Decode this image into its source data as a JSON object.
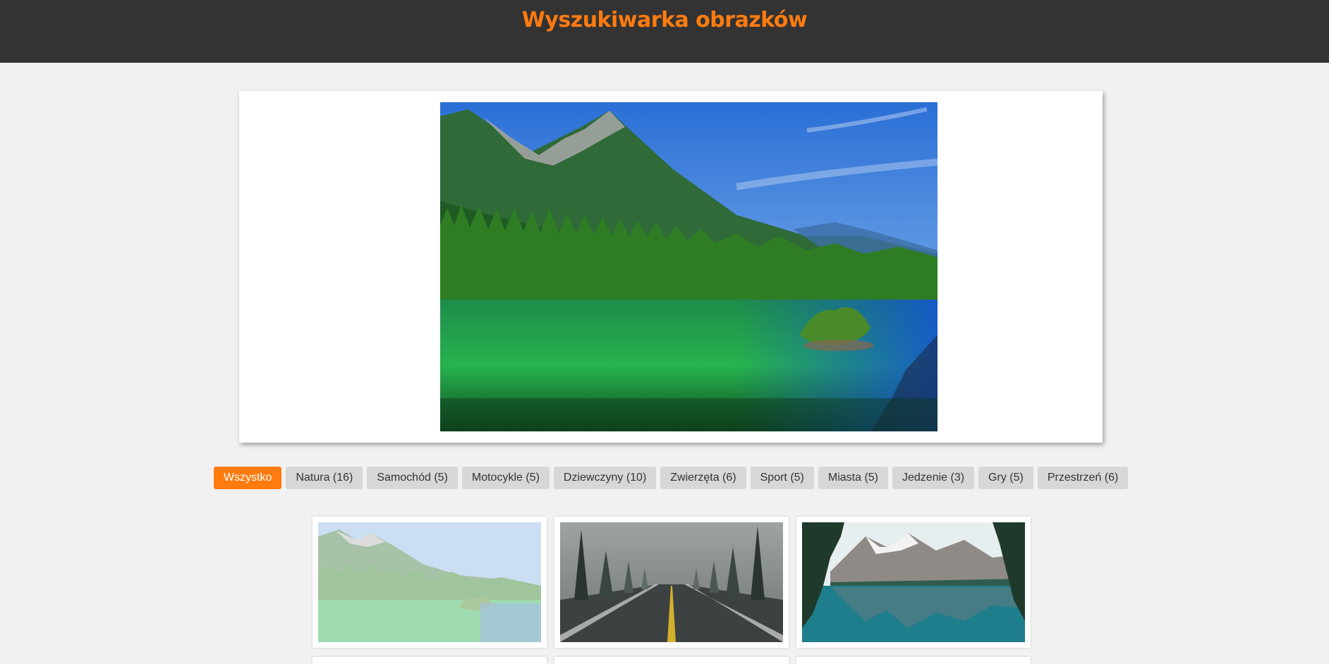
{
  "header": {
    "title": "Wyszukiwarka obrazków"
  },
  "viewer": {
    "image_icon": "mountain-lake-photo"
  },
  "filters": [
    {
      "label": "Wszystko",
      "active": true
    },
    {
      "label": "Natura (16)",
      "active": false
    },
    {
      "label": "Samochód (5)",
      "active": false
    },
    {
      "label": "Motocykle (5)",
      "active": false
    },
    {
      "label": "Dziewczyny (10)",
      "active": false
    },
    {
      "label": "Zwierzęta (6)",
      "active": false
    },
    {
      "label": "Sport (5)",
      "active": false
    },
    {
      "label": "Miasta (5)",
      "active": false
    },
    {
      "label": "Jedzenie (3)",
      "active": false
    },
    {
      "label": "Gry (5)",
      "active": false
    },
    {
      "label": "Przestrzeń (6)",
      "active": false
    }
  ],
  "thumbnails": [
    {
      "icon": "mountain-lake-thumbnail",
      "selected": true
    },
    {
      "icon": "forest-road-thumbnail",
      "selected": false
    },
    {
      "icon": "alpine-lake-thumbnail",
      "selected": false
    }
  ],
  "colors": {
    "header_bg": "#333333",
    "accent": "#ff7b0f",
    "page_bg": "#f1f1f1",
    "filter_bg": "#d7d7d7"
  }
}
